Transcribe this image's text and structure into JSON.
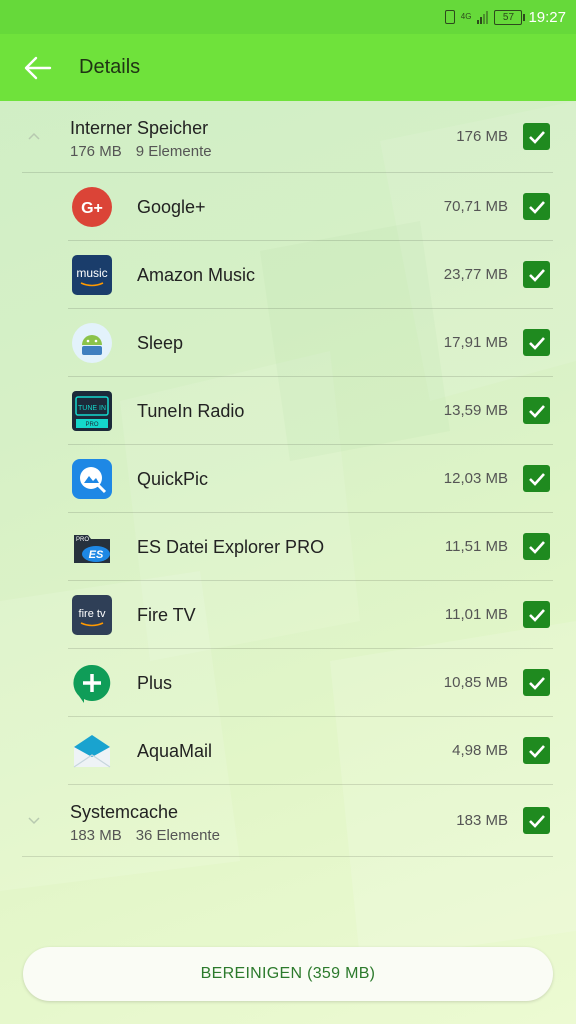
{
  "status_bar": {
    "time": "19:27",
    "battery": "57",
    "network": "4G"
  },
  "app_bar": {
    "title": "Details"
  },
  "internal": {
    "title": "Interner Speicher",
    "size_sub": "176 MB",
    "count": "9 Elemente",
    "size": "176 MB"
  },
  "apps": [
    {
      "name": "Google+",
      "size": "70,71 MB",
      "icon": "google-plus-icon"
    },
    {
      "name": "Amazon Music",
      "size": "23,77 MB",
      "icon": "amazon-music-icon"
    },
    {
      "name": "Sleep",
      "size": "17,91 MB",
      "icon": "sleep-android-icon"
    },
    {
      "name": "TuneIn Radio",
      "size": "13,59 MB",
      "icon": "tunein-radio-icon"
    },
    {
      "name": "QuickPic",
      "size": "12,03 MB",
      "icon": "quickpic-icon"
    },
    {
      "name": "ES Datei Explorer PRO",
      "size": "11,51 MB",
      "icon": "es-file-explorer-icon"
    },
    {
      "name": "Fire TV",
      "size": "11,01 MB",
      "icon": "fire-tv-icon"
    },
    {
      "name": "Plus",
      "size": "10,85 MB",
      "icon": "plus-messenger-icon"
    },
    {
      "name": "AquaMail",
      "size": "4,98 MB",
      "icon": "aquamail-icon"
    }
  ],
  "icon_text": {
    "google_plus": "G+",
    "amazon_music": "music",
    "tunein": "TUNE IN",
    "tunein_pro": "PRO",
    "es_pro": "PRO",
    "es": "ES",
    "fire_tv": "fire tv"
  },
  "system": {
    "title": "Systemcache",
    "size_sub": "183 MB",
    "count": "36 Elemente",
    "size": "183 MB"
  },
  "action": {
    "label": "BEREINIGEN (359 MB)"
  },
  "colors": {
    "accent": "#6fe23b",
    "check": "#1f8a1f",
    "button_text": "#2c7a2c"
  }
}
